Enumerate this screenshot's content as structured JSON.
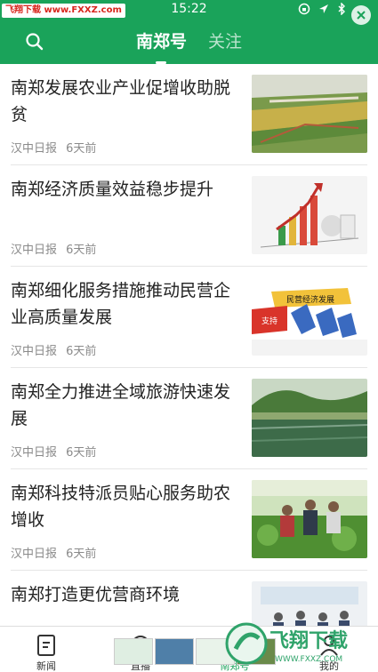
{
  "status_bar": {
    "watermark": "飞翔下载 www.FXXZ.com",
    "time": "15:22"
  },
  "header": {
    "tabs": [
      {
        "label": "南郑号",
        "active": true
      },
      {
        "label": "关注",
        "active": false
      }
    ]
  },
  "articles": [
    {
      "title": "南郑发展农业产业促增收助脱贫",
      "source": "汉中日报",
      "time": "6天前",
      "thumb": "farmland"
    },
    {
      "title": "南郑经济质量效益稳步提升",
      "source": "汉中日报",
      "time": "6天前",
      "thumb": "growth-chart"
    },
    {
      "title": "南郑细化服务措施推动民营企业高质量发展",
      "source": "汉中日报",
      "time": "6天前",
      "thumb": "private-economy"
    },
    {
      "title": "南郑全力推进全域旅游快速发展",
      "source": "汉中日报",
      "time": "6天前",
      "thumb": "lake-scenery"
    },
    {
      "title": "南郑科技特派员贴心服务助农增收",
      "source": "汉中日报",
      "time": "6天前",
      "thumb": "vegetable-field"
    },
    {
      "title": "南郑打造更优营商环境",
      "source": "",
      "time": "",
      "thumb": "meeting"
    }
  ],
  "thumb_texts": {
    "private_economy_sign": "民营经济发展",
    "support_tag": "支持"
  },
  "bottom_tabs": [
    {
      "label": "新闻",
      "icon": "news-icon",
      "active": false
    },
    {
      "label": "直播",
      "icon": "live-icon",
      "active": false
    },
    {
      "label": "南郑号",
      "icon": "nanzheng-icon",
      "active": true
    },
    {
      "label": "我的",
      "icon": "profile-icon",
      "active": false
    }
  ],
  "site_logo": {
    "text": "飞翔下载",
    "sub": "WWW.FXXZ.COM"
  },
  "colors": {
    "brand_green": "#1aa35a",
    "text": "#222222",
    "meta": "#8a8a8a"
  }
}
